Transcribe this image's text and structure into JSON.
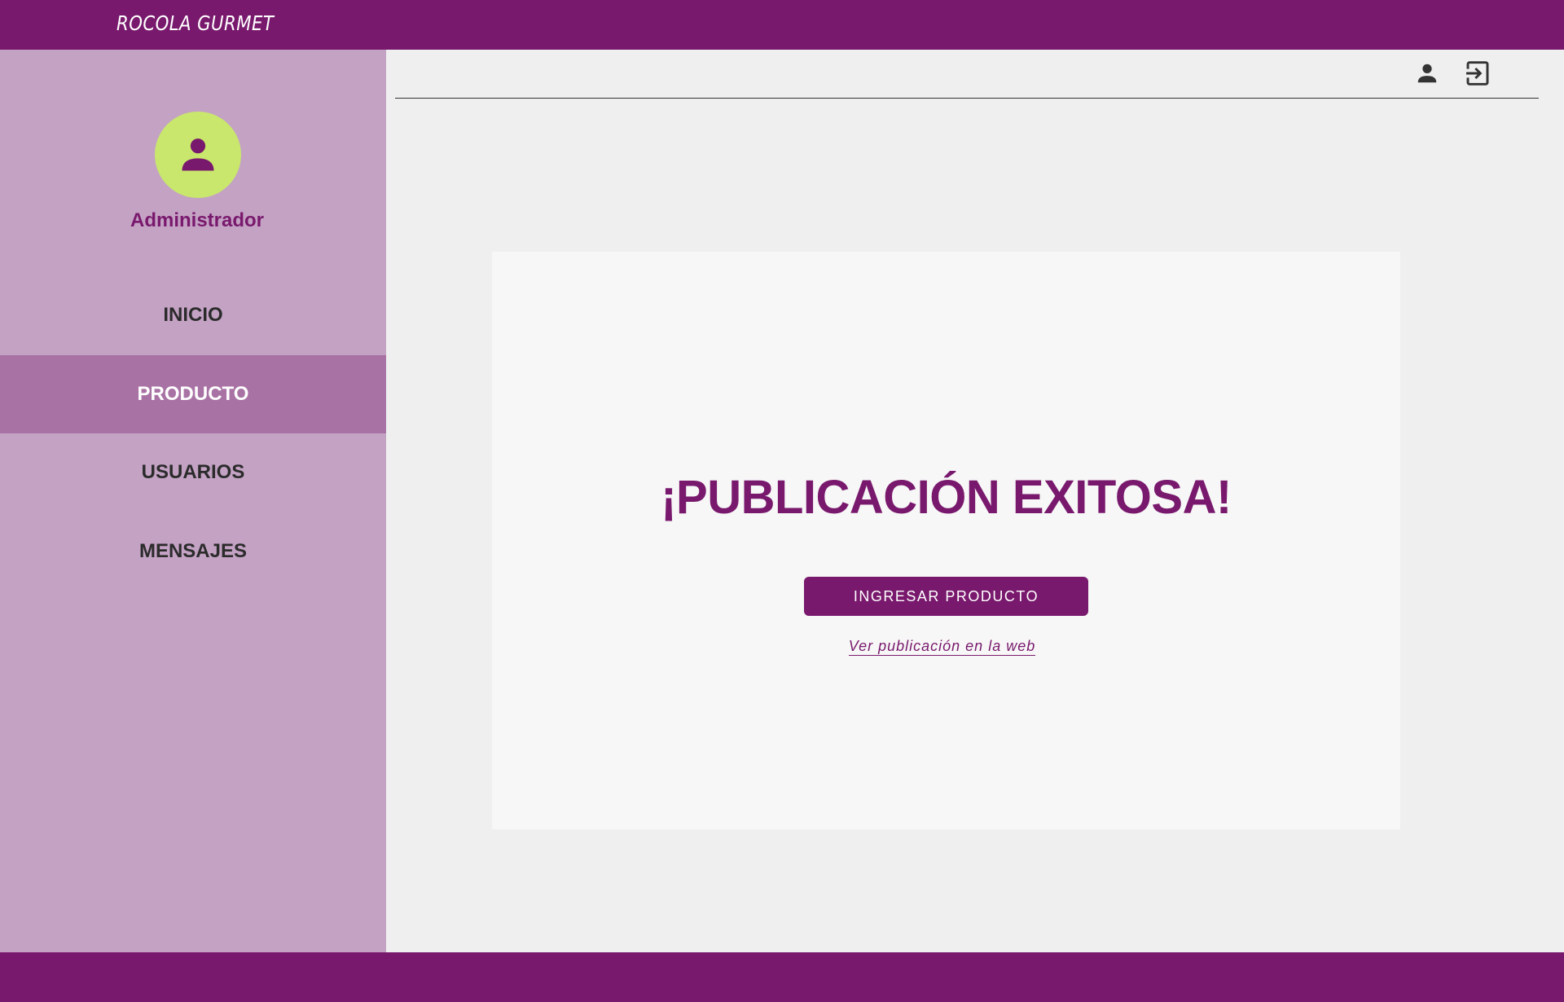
{
  "header": {
    "brand": "ROCOLA GURMET",
    "icons": {
      "profile": "person-icon",
      "logout": "exit-icon"
    }
  },
  "sidebar": {
    "avatar_icon": "person-icon",
    "role": "Administrador",
    "items": [
      {
        "label": "INICIO",
        "active": false
      },
      {
        "label": "PRODUCTO",
        "active": true
      },
      {
        "label": "USUARIOS",
        "active": false
      },
      {
        "label": "MENSAJES",
        "active": false
      }
    ]
  },
  "main": {
    "title": "¡PUBLICACIÓN EXITOSA!",
    "button_label": "INGRESAR PRODUCTO",
    "link_text": "Ver publicación en la web"
  },
  "colors": {
    "primary": "#79196d",
    "sidebar_bg": "#c4a2c4",
    "sidebar_active": "#a972a5",
    "avatar_bg": "#c8e76c",
    "content_bg": "#efefef",
    "card_bg": "#f7f7f7"
  }
}
